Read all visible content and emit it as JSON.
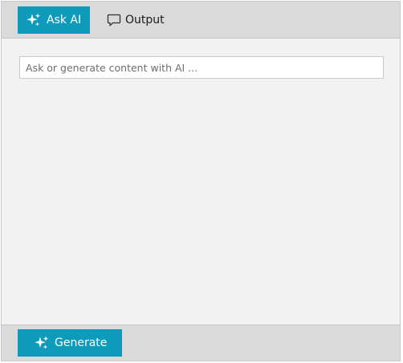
{
  "tabs": {
    "ask_ai": {
      "label": "Ask AI",
      "icon": "sparkle-icon",
      "active": true
    },
    "output": {
      "label": "Output",
      "icon": "chat-bubble-icon",
      "active": false
    }
  },
  "prompt": {
    "value": "",
    "placeholder": "Ask or generate content with AI ..."
  },
  "footer": {
    "generate_label": "Generate",
    "generate_icon": "sparkle-icon"
  },
  "colors": {
    "accent": "#0e9abb",
    "toolbar_bg": "#dadada",
    "panel_bg": "#f2f2f2"
  }
}
